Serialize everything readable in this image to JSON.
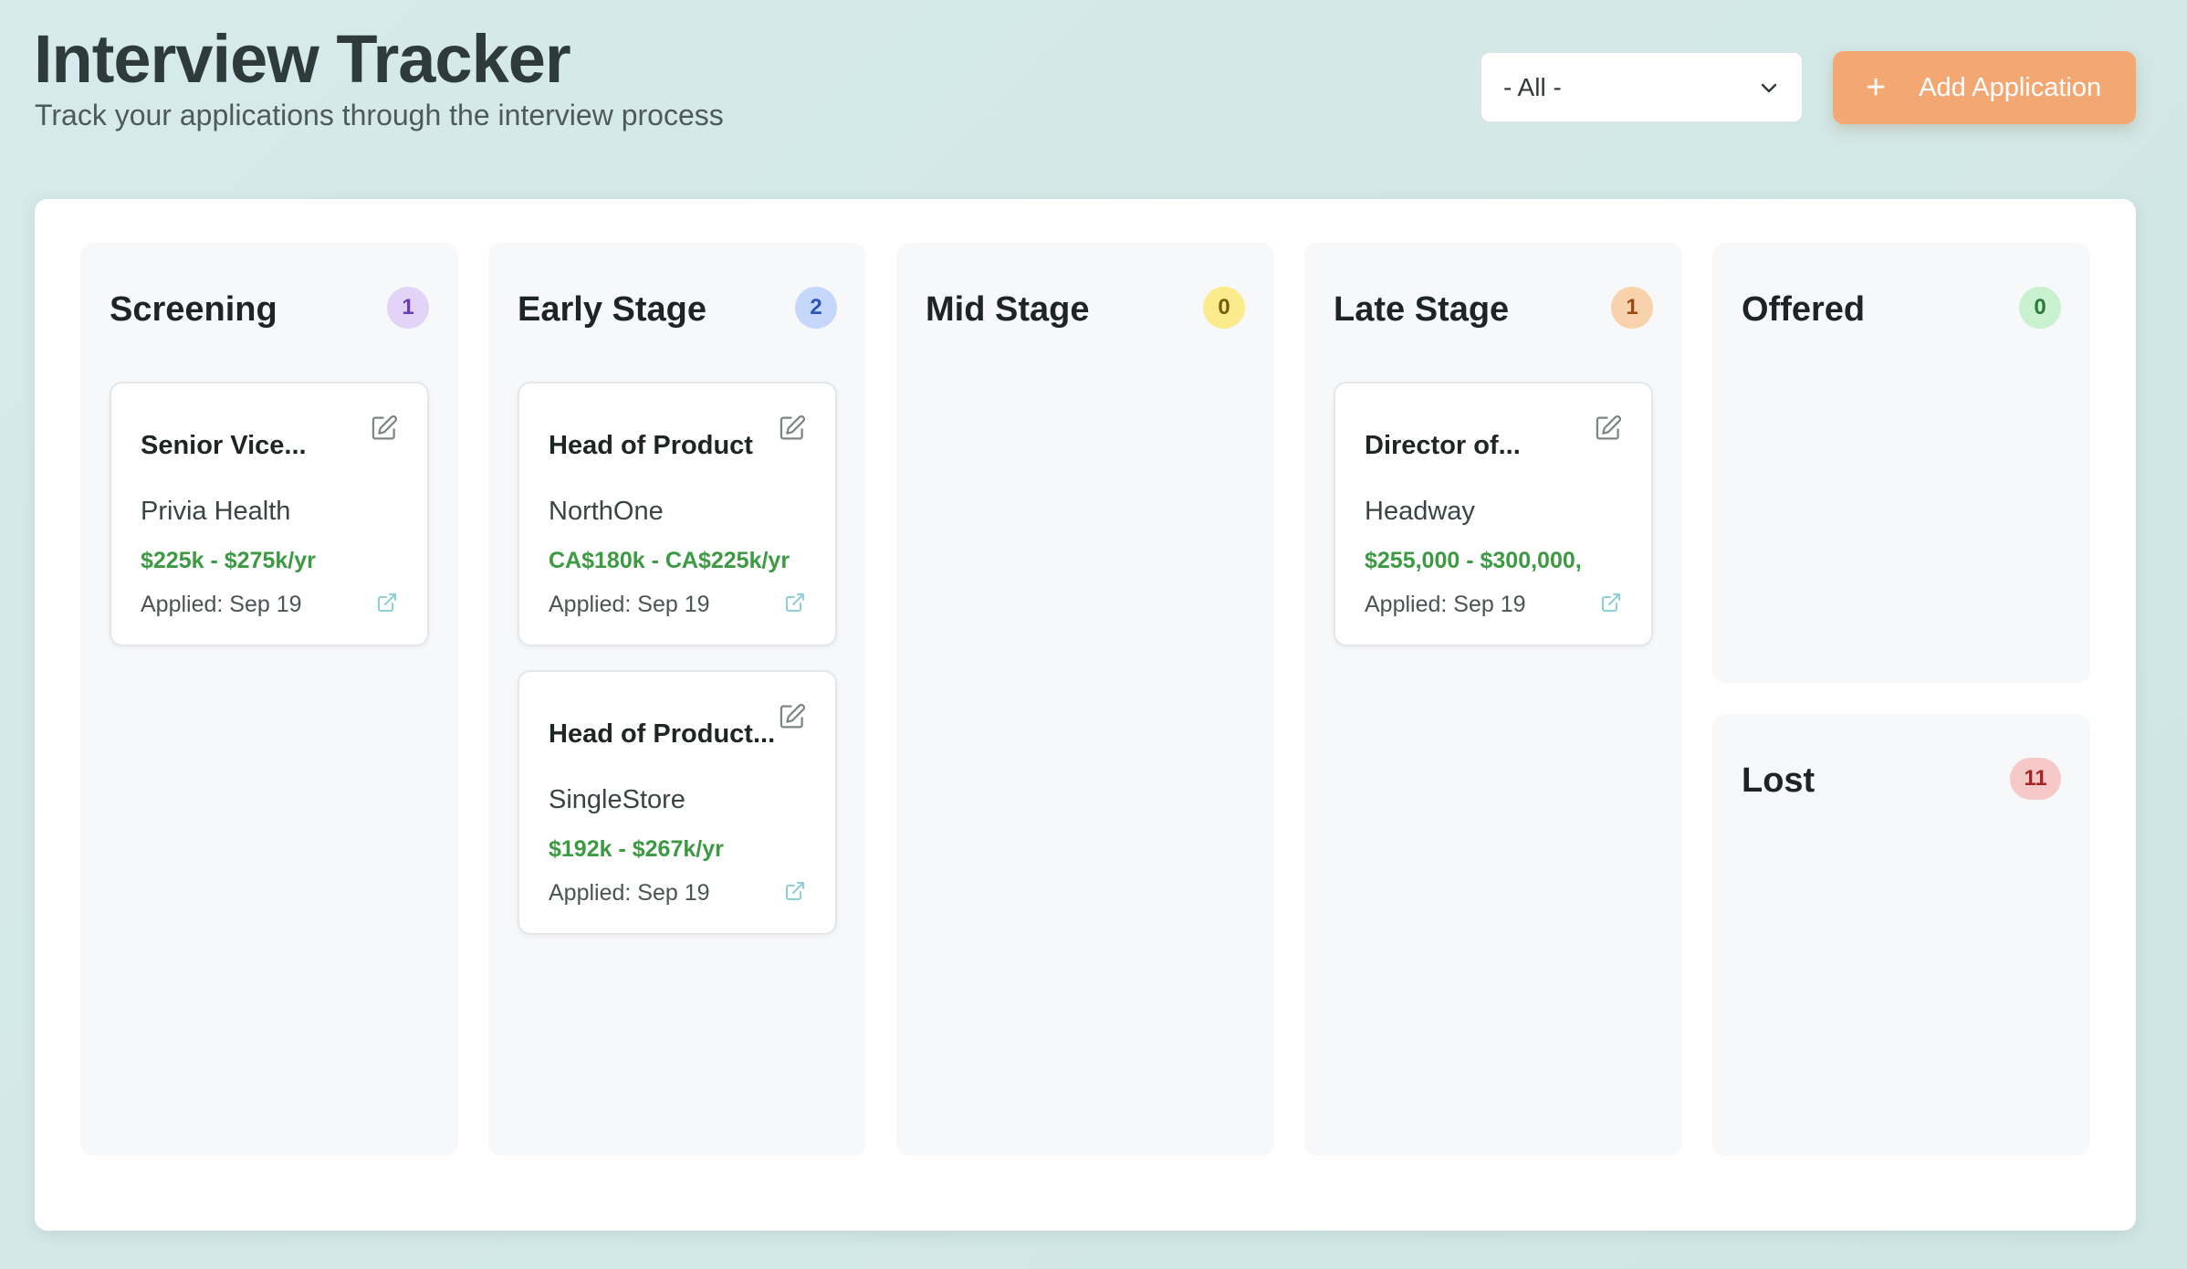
{
  "header": {
    "title": "Interview Tracker",
    "subtitle": "Track your applications through the interview process"
  },
  "filter": {
    "selected": "- All -"
  },
  "add_button": {
    "label": "Add Application"
  },
  "columns": [
    {
      "title": "Screening",
      "count": "1",
      "badge_bg": "#e3d3f7",
      "badge_fg": "#6b3fb0"
    },
    {
      "title": "Early Stage",
      "count": "2",
      "badge_bg": "#c5d8fb",
      "badge_fg": "#2e56b8"
    },
    {
      "title": "Mid Stage",
      "count": "0",
      "badge_bg": "#fbeb8c",
      "badge_fg": "#7a5a0b"
    },
    {
      "title": "Late Stage",
      "count": "1",
      "badge_bg": "#f8d2ad",
      "badge_fg": "#9a4a12"
    },
    {
      "title": "Offered",
      "count": "0",
      "badge_bg": "#c9f0cf",
      "badge_fg": "#2b7a37"
    },
    {
      "title": "Lost",
      "count": "11",
      "badge_bg": "#f6c9c9",
      "badge_fg": "#a52626"
    }
  ],
  "cards": {
    "screening": [
      {
        "title": "Senior Vice...",
        "company": "Privia Health",
        "salary": "$225k - $275k/yr",
        "applied": "Applied: Sep 19"
      }
    ],
    "early": [
      {
        "title": "Head of Product",
        "company": "NorthOne",
        "salary": "CA$180k - CA$225k/yr",
        "applied": "Applied: Sep 19"
      },
      {
        "title": "Head of Product...",
        "company": "SingleStore",
        "salary": "$192k - $267k/yr",
        "applied": "Applied: Sep 19"
      }
    ],
    "late": [
      {
        "title": "Director of...",
        "company": "Headway",
        "salary": "$255,000 - $300,000,",
        "applied": "Applied: Sep 19"
      }
    ]
  },
  "colors": {
    "accent": "#f3a873",
    "salary": "#3c9a42",
    "icon": "#7d8585",
    "link_icon": "#8ecfd6"
  },
  "icons": {
    "edit": "edit-icon",
    "external_link": "external-link-icon",
    "chevron": "chevron-down-icon",
    "plus": "plus-icon"
  }
}
